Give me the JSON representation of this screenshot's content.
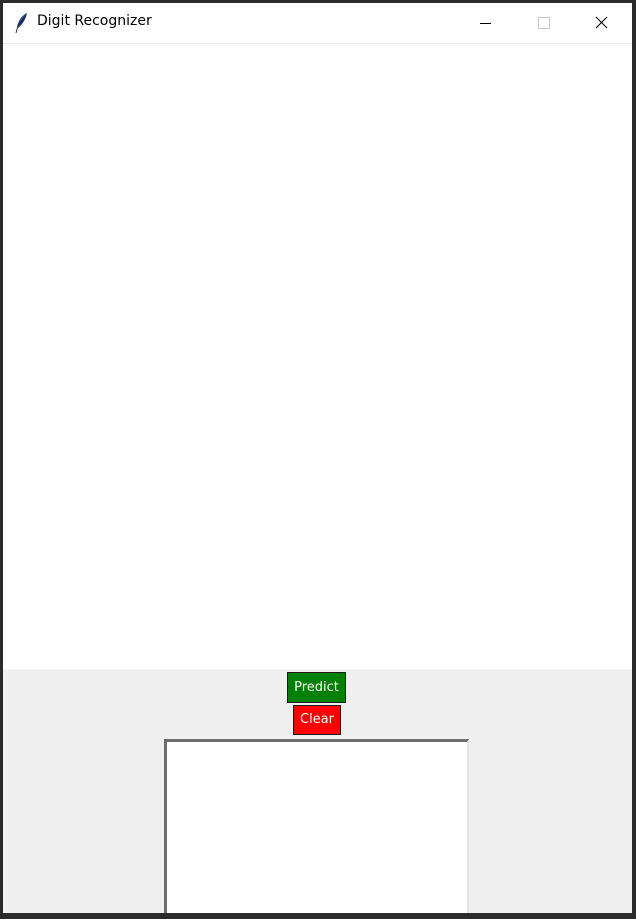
{
  "window": {
    "title": "Digit Recognizer",
    "icon": "feather-icon",
    "controls": [
      "minimize-icon",
      "maximize-icon",
      "close-icon"
    ]
  },
  "buttons": {
    "predict_label": "Predict",
    "clear_label": "Clear"
  },
  "result": {
    "text": ""
  },
  "colors": {
    "predict_bg": "#008000",
    "clear_bg": "#ff0000",
    "canvas_bg": "#ffffff",
    "window_bg": "#f0f0f0"
  }
}
